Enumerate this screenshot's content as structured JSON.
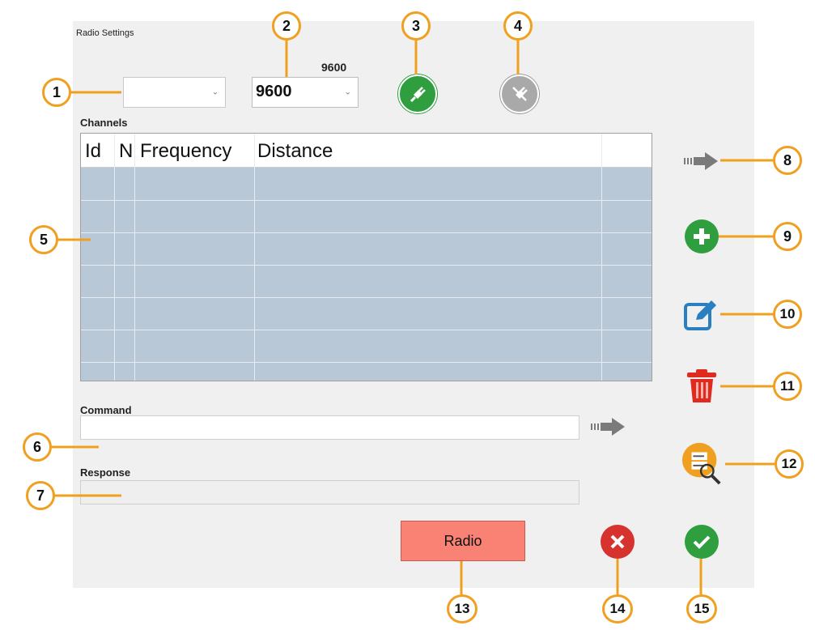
{
  "window": {
    "title": "Radio Settings"
  },
  "port": {
    "value": ""
  },
  "baud": {
    "caption": "9600",
    "value": "9600"
  },
  "channels": {
    "label": "Channels",
    "columns": [
      "Id",
      "N",
      "Frequency",
      "Distance",
      ""
    ]
  },
  "command": {
    "label": "Command",
    "value": ""
  },
  "response": {
    "label": "Response",
    "value": ""
  },
  "buttons": {
    "radio": "Radio"
  },
  "callouts": [
    "1",
    "2",
    "3",
    "4",
    "5",
    "6",
    "7",
    "8",
    "9",
    "10",
    "11",
    "12",
    "13",
    "14",
    "15"
  ],
  "colors": {
    "accent": "#f0a020",
    "green": "#2e9e3f",
    "red": "#d6332f",
    "blue": "#2a7fc1",
    "grid": "#b9c8d6",
    "radio": "#f98274"
  }
}
